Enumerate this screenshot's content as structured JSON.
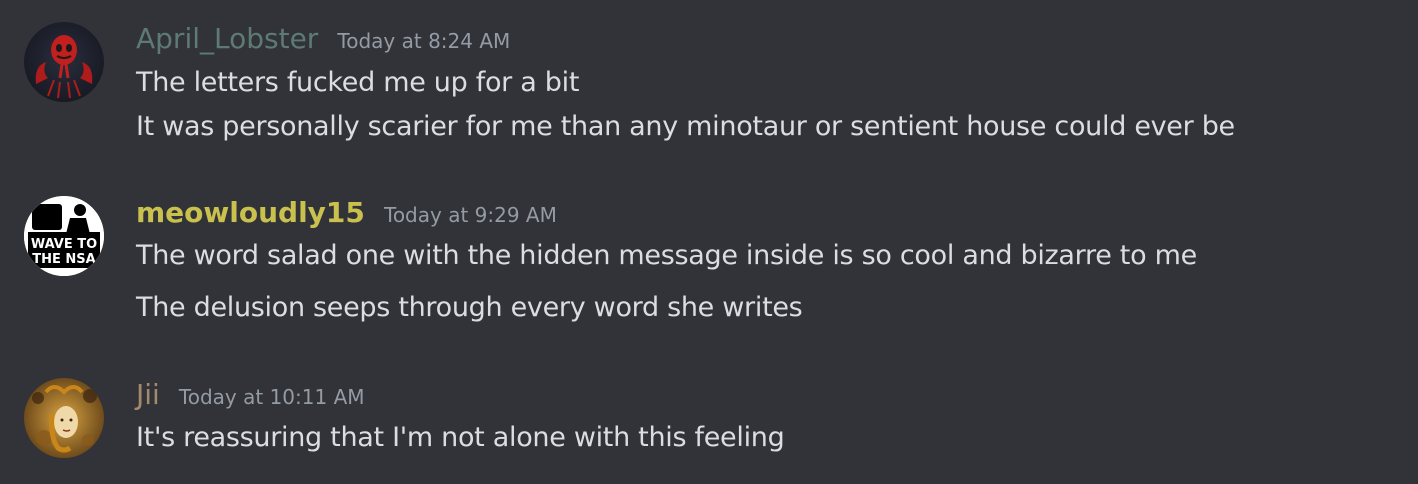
{
  "messages": [
    {
      "username": "April_Lobster",
      "username_color": "#5d7a73",
      "timestamp": "Today at 8:24 AM",
      "avatar_icon": "red-lobster-mask-avatar",
      "lines": [
        "The letters fucked me up for a bit",
        "It was personally scarier for me than any minotaur or sentient house could ever be"
      ]
    },
    {
      "username": "meowloudly15",
      "username_color": "#c9c04d",
      "timestamp": "Today at 9:29 AM",
      "avatar_icon": "wave-to-the-nsa-avatar",
      "avatar_text_1": "WAVE TO",
      "avatar_text_2": "THE NSA",
      "lines": [
        "The word salad one with the hidden message inside is so cool and bizarre to me",
        "The delusion seeps through every word she writes"
      ]
    },
    {
      "username": "Jii",
      "username_color": "#a48a6d",
      "timestamp": "Today at 10:11 AM",
      "avatar_icon": "golden-ornate-portrait-avatar",
      "lines": [
        "It's reassuring that I'm not alone with this feeling"
      ]
    }
  ]
}
